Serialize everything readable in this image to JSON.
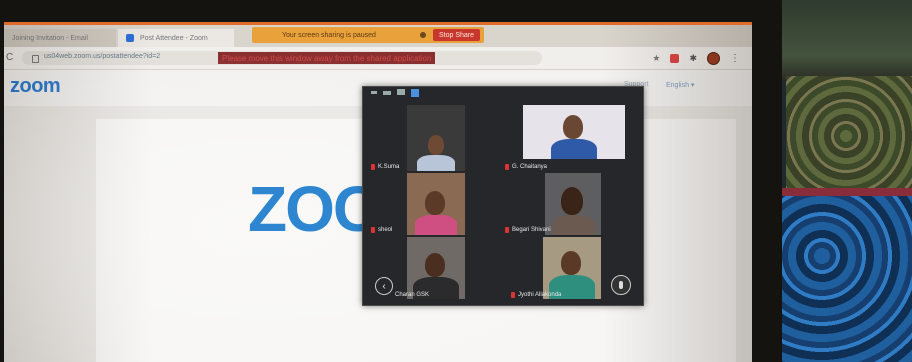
{
  "browser": {
    "tabs": [
      {
        "label": "Joining Invitation - Email"
      },
      {
        "label": "Post Attendee - Zoom"
      }
    ],
    "share_bar": {
      "message": "Your screen sharing is paused",
      "stop_label": "Stop Share"
    },
    "url": "us04web.zoom.us/postattendee?id=2",
    "warning": "Please move this window away from the shared application"
  },
  "page": {
    "logo": "zoom",
    "support": "Support",
    "language": "English ▾",
    "big_logo": "ZOO"
  },
  "gallery": {
    "participants": [
      {
        "name": "K.Suma"
      },
      {
        "name": "G. Chaitanya"
      },
      {
        "name": "sheol"
      },
      {
        "name": "Begari Shivani"
      },
      {
        "name": "Charan GSK"
      },
      {
        "name": "Jyothi Allakonda"
      }
    ]
  },
  "colors": {
    "zoom_blue": "#2d86cf",
    "share_bar": "#e9a23b",
    "stop_button": "#c8372e",
    "gallery_bg": "#26272b"
  },
  "icons": [
    "lock-icon",
    "star-icon",
    "extension-icon",
    "puzzle-icon",
    "profile-avatar",
    "menu-icon",
    "back-icon",
    "mic-muted-icon"
  ]
}
